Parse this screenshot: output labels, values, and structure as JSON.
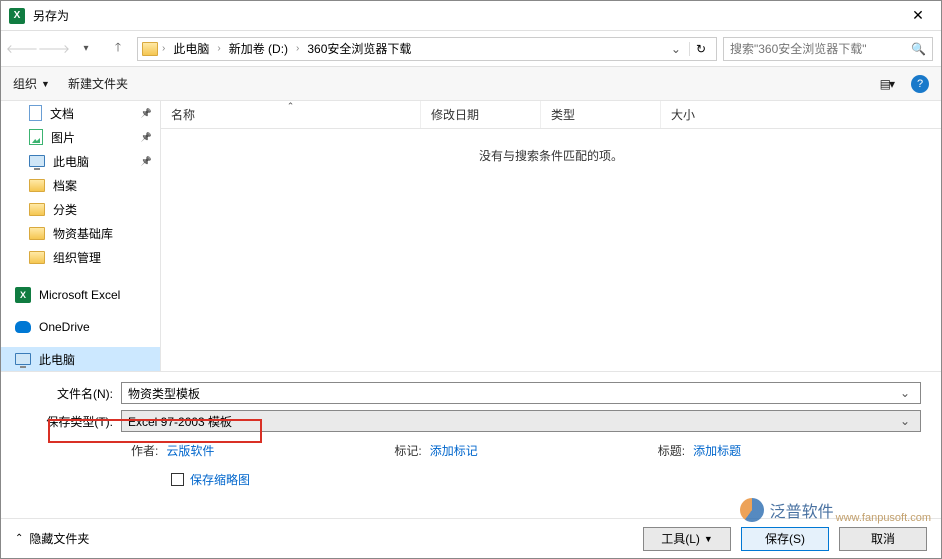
{
  "window": {
    "title": "另存为"
  },
  "breadcrumb": {
    "root": "此电脑",
    "drive": "新加卷 (D:)",
    "folder": "360安全浏览器下载"
  },
  "search": {
    "placeholder": "搜索\"360安全浏览器下载\""
  },
  "toolbar": {
    "organize": "组织",
    "newfolder": "新建文件夹"
  },
  "sidebar": {
    "items": [
      {
        "label": "文档",
        "icon": "doc",
        "pinned": true
      },
      {
        "label": "图片",
        "icon": "pic",
        "pinned": true
      },
      {
        "label": "此电脑",
        "icon": "pc",
        "pinned": true
      },
      {
        "label": "档案",
        "icon": "folder"
      },
      {
        "label": "分类",
        "icon": "folder"
      },
      {
        "label": "物资基础库",
        "icon": "folder"
      },
      {
        "label": "组织管理",
        "icon": "folder"
      },
      {
        "label": "Microsoft Excel",
        "icon": "excel",
        "inset": false
      },
      {
        "label": "OneDrive",
        "icon": "onedrive",
        "inset": false
      },
      {
        "label": "此电脑",
        "icon": "pc",
        "inset": false,
        "selected": true
      }
    ]
  },
  "list": {
    "headers": {
      "name": "名称",
      "date": "修改日期",
      "type": "类型",
      "size": "大小"
    },
    "empty": "没有与搜索条件匹配的项。"
  },
  "form": {
    "filename_label": "文件名(N):",
    "filename_value": "物资类型模板",
    "filetype_label": "保存类型(T):",
    "filetype_value": "Excel 97-2003 模板"
  },
  "meta": {
    "author_label": "作者:",
    "author_value": "云版软件",
    "tag_label": "标记:",
    "tag_value": "添加标记",
    "title_label": "标题:",
    "title_value": "添加标题",
    "thumb_label": "保存缩略图"
  },
  "footer": {
    "hide_folders": "隐藏文件夹",
    "tools": "工具(L)",
    "save": "保存(S)",
    "cancel": "取消"
  },
  "watermark": {
    "name": "泛普软件",
    "url": "www.fanpusoft.com"
  }
}
